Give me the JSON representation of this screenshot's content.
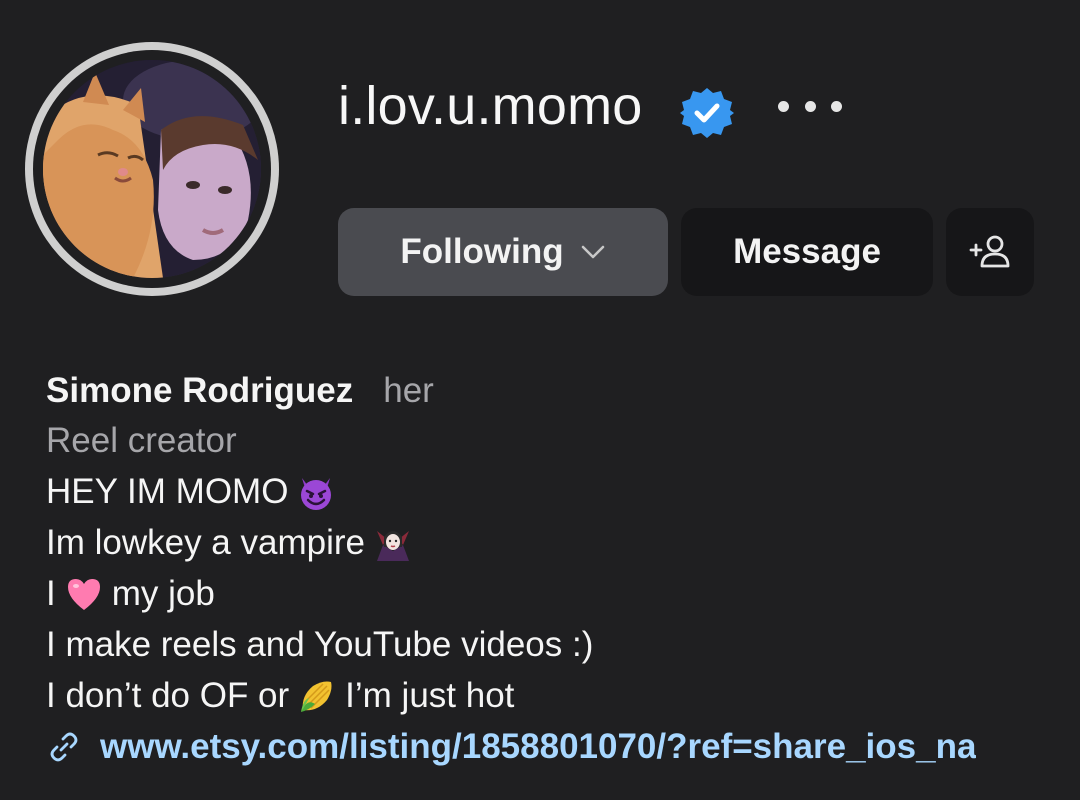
{
  "profile": {
    "username": "i.lov.u.momo",
    "verified_icon": "verified-badge-icon",
    "more_icon": "more-options-icon",
    "avatar": "profile-photo-avatar"
  },
  "actions": {
    "following_label": "Following",
    "message_label": "Message",
    "add_user_icon": "add-person-icon"
  },
  "bio": {
    "full_name": "Simone Rodriguez",
    "pronouns": "her",
    "category": "Reel creator",
    "line1": {
      "before": "HEY IM MOMO",
      "emoji": "smiling-devil-emoji"
    },
    "line2": {
      "before": "Im lowkey a vampire",
      "emoji": "vampire-emoji"
    },
    "line3": {
      "before": "I",
      "emoji": "pink-heart-emoji",
      "after": "my job"
    },
    "line4": "I make reels and YouTube videos :)",
    "line5": {
      "before": "I don’t do OF or",
      "emoji": "corn-emoji",
      "after": "I’m just hot"
    },
    "link": "www.etsy.com/listing/1858801070/?ref=share_ios_na"
  },
  "colors": {
    "background": "#1f1f21",
    "following_button": "#4a4b50",
    "secondary_button": "#161618",
    "verified_blue": "#3897f0",
    "link_blue": "#a8d7ff",
    "muted_text": "#a6a6aa"
  }
}
